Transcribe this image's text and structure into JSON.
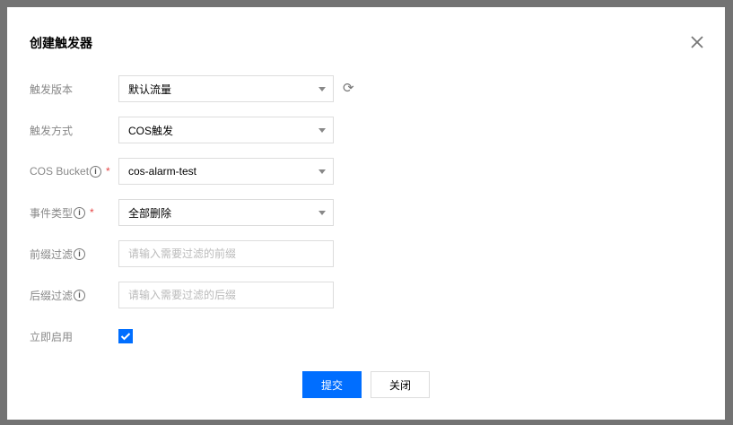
{
  "dialog": {
    "title": "创建触发器"
  },
  "form": {
    "version": {
      "label": "触发版本",
      "value": "默认流量"
    },
    "method": {
      "label": "触发方式",
      "value": "COS触发"
    },
    "bucket": {
      "label": "COS Bucket",
      "value": "cos-alarm-test",
      "required": "*"
    },
    "event": {
      "label": "事件类型",
      "value": "全部删除",
      "required": "*"
    },
    "prefix": {
      "label": "前缀过滤",
      "placeholder": "请输入需要过滤的前缀"
    },
    "suffix": {
      "label": "后缀过滤",
      "placeholder": "请输入需要过滤的后缀"
    },
    "enable": {
      "label": "立即启用",
      "checked": true
    }
  },
  "buttons": {
    "submit": "提交",
    "close": "关闭"
  },
  "info_glyph": "i",
  "colors": {
    "primary": "#006eff",
    "required": "#e54545"
  }
}
